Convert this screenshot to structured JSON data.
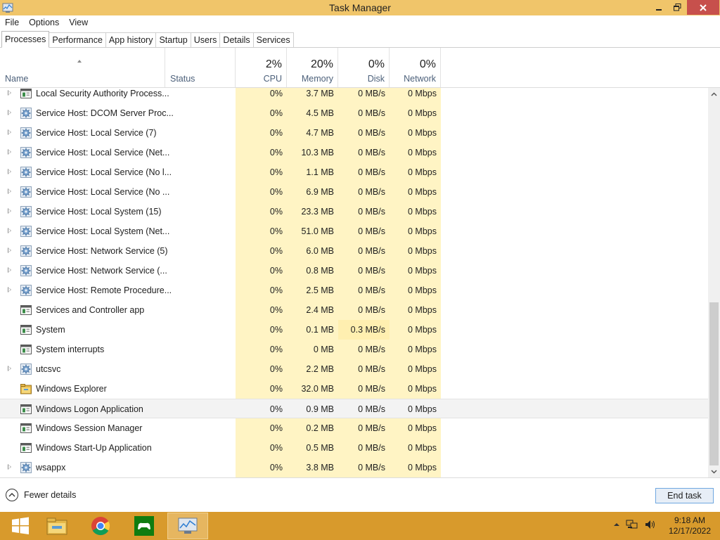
{
  "window": {
    "title": "Task Manager"
  },
  "menu": [
    "File",
    "Options",
    "View"
  ],
  "tabs": [
    "Processes",
    "Performance",
    "App history",
    "Startup",
    "Users",
    "Details",
    "Services"
  ],
  "active_tab": "Processes",
  "header": {
    "name": "Name",
    "status": "Status",
    "cpu": {
      "pct": "2%",
      "label": "CPU"
    },
    "memory": {
      "pct": "20%",
      "label": "Memory"
    },
    "disk": {
      "pct": "0%",
      "label": "Disk"
    },
    "network": {
      "pct": "0%",
      "label": "Network"
    }
  },
  "rows": [
    {
      "name": "Local Security Authority Process...",
      "icon": "app-icon",
      "expandable": true,
      "cpu": "0%",
      "memory": "3.7 MB",
      "disk": "0 MB/s",
      "network": "0 Mbps"
    },
    {
      "name": "Service Host: DCOM Server Proc...",
      "icon": "gear-icon",
      "expandable": true,
      "cpu": "0%",
      "memory": "4.5 MB",
      "disk": "0 MB/s",
      "network": "0 Mbps"
    },
    {
      "name": "Service Host: Local Service (7)",
      "icon": "gear-icon",
      "expandable": true,
      "cpu": "0%",
      "memory": "4.7 MB",
      "disk": "0 MB/s",
      "network": "0 Mbps"
    },
    {
      "name": "Service Host: Local Service (Net...",
      "icon": "gear-icon",
      "expandable": true,
      "cpu": "0%",
      "memory": "10.3 MB",
      "disk": "0 MB/s",
      "network": "0 Mbps"
    },
    {
      "name": "Service Host: Local Service (No l...",
      "icon": "gear-icon",
      "expandable": true,
      "cpu": "0%",
      "memory": "1.1 MB",
      "disk": "0 MB/s",
      "network": "0 Mbps"
    },
    {
      "name": "Service Host: Local Service (No ...",
      "icon": "gear-icon",
      "expandable": true,
      "cpu": "0%",
      "memory": "6.9 MB",
      "disk": "0 MB/s",
      "network": "0 Mbps"
    },
    {
      "name": "Service Host: Local System (15)",
      "icon": "gear-icon",
      "expandable": true,
      "cpu": "0%",
      "memory": "23.3 MB",
      "disk": "0 MB/s",
      "network": "0 Mbps"
    },
    {
      "name": "Service Host: Local System (Net...",
      "icon": "gear-icon",
      "expandable": true,
      "cpu": "0%",
      "memory": "51.0 MB",
      "disk": "0 MB/s",
      "network": "0 Mbps"
    },
    {
      "name": "Service Host: Network Service (5)",
      "icon": "gear-icon",
      "expandable": true,
      "cpu": "0%",
      "memory": "6.0 MB",
      "disk": "0 MB/s",
      "network": "0 Mbps"
    },
    {
      "name": "Service Host: Network Service (...",
      "icon": "gear-icon",
      "expandable": true,
      "cpu": "0%",
      "memory": "0.8 MB",
      "disk": "0 MB/s",
      "network": "0 Mbps"
    },
    {
      "name": "Service Host: Remote Procedure...",
      "icon": "gear-icon",
      "expandable": true,
      "cpu": "0%",
      "memory": "2.5 MB",
      "disk": "0 MB/s",
      "network": "0 Mbps"
    },
    {
      "name": "Services and Controller app",
      "icon": "app-icon",
      "expandable": false,
      "cpu": "0%",
      "memory": "2.4 MB",
      "disk": "0 MB/s",
      "network": "0 Mbps"
    },
    {
      "name": "System",
      "icon": "app-icon",
      "expandable": false,
      "cpu": "0%",
      "memory": "0.1 MB",
      "disk": "0.3 MB/s",
      "network": "0 Mbps",
      "disk_highlight": true
    },
    {
      "name": "System interrupts",
      "icon": "app-icon",
      "expandable": false,
      "cpu": "0%",
      "memory": "0 MB",
      "disk": "0 MB/s",
      "network": "0 Mbps"
    },
    {
      "name": "utcsvc",
      "icon": "gear-icon",
      "expandable": true,
      "cpu": "0%",
      "memory": "2.2 MB",
      "disk": "0 MB/s",
      "network": "0 Mbps"
    },
    {
      "name": "Windows Explorer",
      "icon": "folder-icon",
      "expandable": false,
      "cpu": "0%",
      "memory": "32.0 MB",
      "disk": "0 MB/s",
      "network": "0 Mbps"
    },
    {
      "name": "Windows Logon Application",
      "icon": "app-icon",
      "expandable": false,
      "cpu": "0%",
      "memory": "0.9 MB",
      "disk": "0 MB/s",
      "network": "0 Mbps",
      "selected": true
    },
    {
      "name": "Windows Session Manager",
      "icon": "app-icon",
      "expandable": false,
      "cpu": "0%",
      "memory": "0.2 MB",
      "disk": "0 MB/s",
      "network": "0 Mbps"
    },
    {
      "name": "Windows Start-Up Application",
      "icon": "app-icon",
      "expandable": false,
      "cpu": "0%",
      "memory": "0.5 MB",
      "disk": "0 MB/s",
      "network": "0 Mbps"
    },
    {
      "name": "wsappx",
      "icon": "gear-icon",
      "expandable": true,
      "cpu": "0%",
      "memory": "3.8 MB",
      "disk": "0 MB/s",
      "network": "0 Mbps"
    }
  ],
  "footer": {
    "fewer_details": "Fewer details",
    "end_task": "End task"
  },
  "taskbar": {
    "items": [
      "windows-start-icon",
      "file-explorer-icon",
      "chrome-icon",
      "xbox-icon",
      "task-manager-icon"
    ],
    "clock_time": "9:18 AM",
    "clock_date": "12/17/2022"
  },
  "colors": {
    "titlebar": "#f0c56a",
    "taskbar": "#d89a2c",
    "heat": "#fff4c4",
    "close": "#c7504c"
  }
}
